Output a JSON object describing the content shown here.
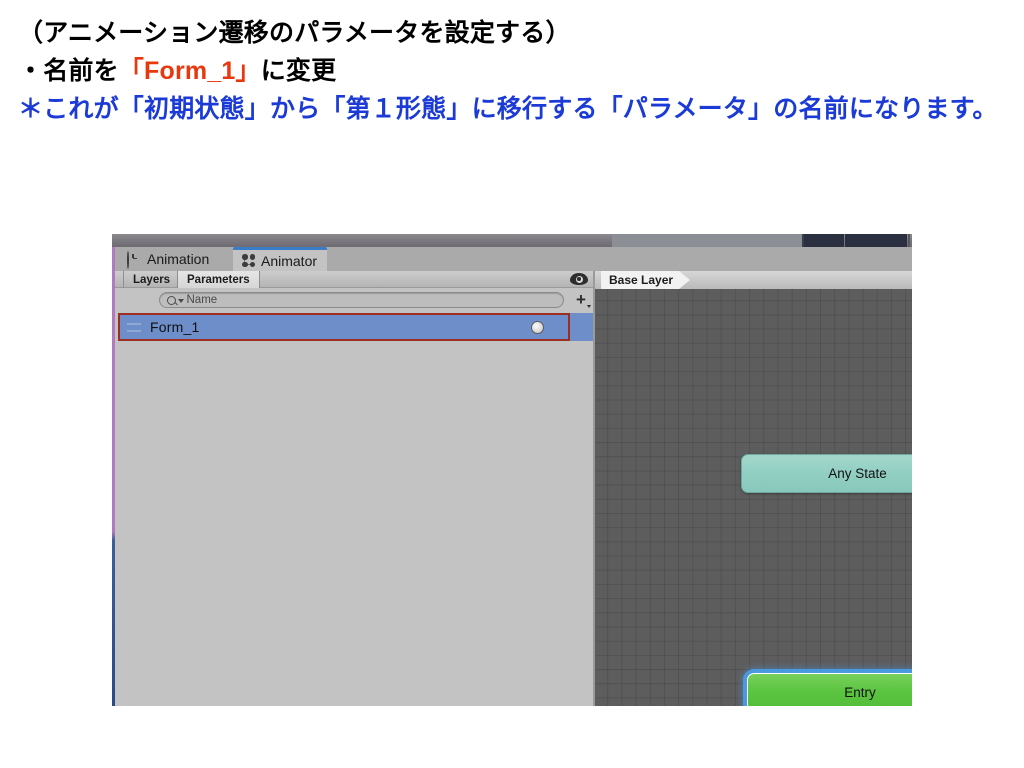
{
  "slide": {
    "lines": [
      {
        "id": "l1",
        "text": "（アニメーション遷移のパラメータを設定する）",
        "color": "#000000"
      },
      {
        "id": "l2a",
        "text": "・名前を",
        "color": "#000000"
      },
      {
        "id": "l2b",
        "text": "「Form_1」",
        "color": "#e8380d"
      },
      {
        "id": "l2c",
        "text": "に変更",
        "color": "#000000"
      },
      {
        "id": "l3",
        "text": "＊これが「初期状態」から「第１形態」に移行する「パラメータ」の名前になります。",
        "color": "#1b3ad6"
      }
    ]
  },
  "editor": {
    "tabs": [
      {
        "label": "Animation",
        "icon": "clock-icon",
        "active": false
      },
      {
        "label": "Animator",
        "icon": "node-graph-icon",
        "active": true
      }
    ],
    "parameters_panel": {
      "subtabs": [
        {
          "label": "Layers",
          "active": false
        },
        {
          "label": "Parameters",
          "active": true
        }
      ],
      "search": {
        "placeholder": "Name",
        "value": "",
        "icon": "search-icon"
      },
      "add_button_label": "+",
      "visibility_icon": "eye-icon",
      "rows": [
        {
          "name": "Form_1",
          "type": "Trigger",
          "selected": true,
          "highlight_color": "#9c2f22",
          "selection_color": "#6d8ec9"
        }
      ]
    },
    "graph_panel": {
      "breadcrumb": "Base Layer",
      "nodes": [
        {
          "id": "any-state",
          "label": "Any State",
          "color": "#92cfc3",
          "selected": false
        },
        {
          "id": "entry",
          "label": "Entry",
          "color": "#5bc441",
          "selected": true
        }
      ],
      "transitions": [
        {
          "from": "entry",
          "to": "offscreen",
          "color": "#c0821c"
        }
      ]
    }
  },
  "colors": {
    "accent_red": "#e8380d",
    "accent_blue": "#1b3ad6",
    "selection_blue": "#6d8ec9",
    "highlight_border": "#9c2f22",
    "entry_green": "#5bc441",
    "any_state_teal": "#92cfc3",
    "transition_orange": "#c0821c",
    "canvas_gray": "#5d5d5d",
    "panel_gray": "#c3c3c3"
  }
}
